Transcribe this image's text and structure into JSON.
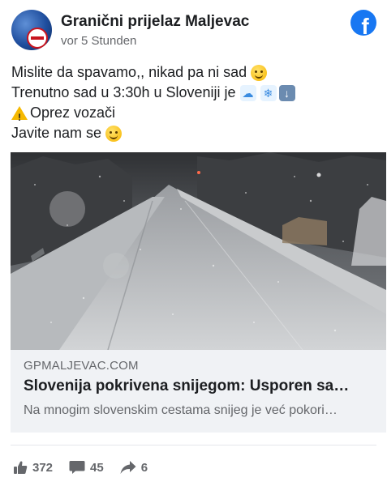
{
  "post": {
    "page_name": "Granični prijelaz Maljevac",
    "timestamp": "vor 5 Stunden",
    "lines": [
      "Mislite da spavamo,, nikad pa ni sad",
      "Trenutno sad u 3:30h u Sloveniji je",
      "Oprez vozači",
      "Javite nam se"
    ]
  },
  "link": {
    "domain": "GPMALJEVAC.COM",
    "title": "Slovenija pokrivena snijegom: Usporen sa…",
    "description": "Na mnogim slovenskim cestama snijeg je već pokori…"
  },
  "actions": {
    "likes": "372",
    "comments": "45",
    "shares": "6"
  },
  "icons": {
    "logo": "facebook-logo-icon",
    "avatar": "page-avatar",
    "like": "thumbs-up-icon",
    "comment": "comment-bubble-icon",
    "share": "share-arrow-icon"
  },
  "colors": {
    "brand": "#1877f2",
    "text": "#1c1e21",
    "muted": "#65676b",
    "card_bg": "#f0f2f5"
  }
}
